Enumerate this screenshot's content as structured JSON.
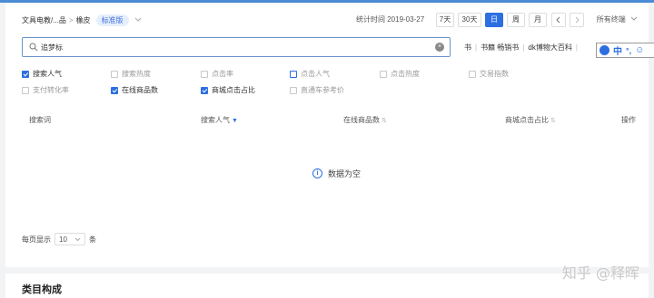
{
  "header": {
    "breadcrumb_left": "文具电教/...品",
    "breadcrumb_sep": ">",
    "breadcrumb_right": "橡皮",
    "edition_badge": "标准版",
    "stat_time": "统计时间 2019-03-27",
    "range_buttons": [
      "7天",
      "30天",
      "日",
      "周",
      "月"
    ],
    "active_range": "日",
    "terminal_select": "所有终端"
  },
  "search": {
    "value": "追梦标"
  },
  "top_links": [
    "书",
    "书籍 畅销书",
    "dk博物大百科"
  ],
  "metrics": [
    {
      "label": "搜索人气",
      "checked": true
    },
    {
      "label": "搜索热度",
      "checked": false
    },
    {
      "label": "点击率",
      "checked": false
    },
    {
      "label": "点击人气",
      "checked": false
    },
    {
      "label": "点击热度",
      "checked": false
    },
    {
      "label": "交易指数",
      "checked": false
    },
    {
      "label": "支付转化率",
      "checked": false
    },
    {
      "label": "在线商品数",
      "checked": true
    },
    {
      "label": "商城点击占比",
      "checked": true
    },
    {
      "label": "直通车参考价",
      "checked": false
    }
  ],
  "table": {
    "headers": [
      "搜索词",
      "搜索人气",
      "在线商品数",
      "商城点击占比",
      "操作"
    ],
    "empty_text": "数据为空"
  },
  "pager": {
    "prefix": "每页显示",
    "size": "10",
    "suffix": "条"
  },
  "section_title": "类目构成",
  "ime": {
    "lang": "中"
  },
  "watermark": "知乎 @释晖",
  "colors": {
    "accent": "#2d6fe0",
    "band": "#4a8bd6"
  }
}
